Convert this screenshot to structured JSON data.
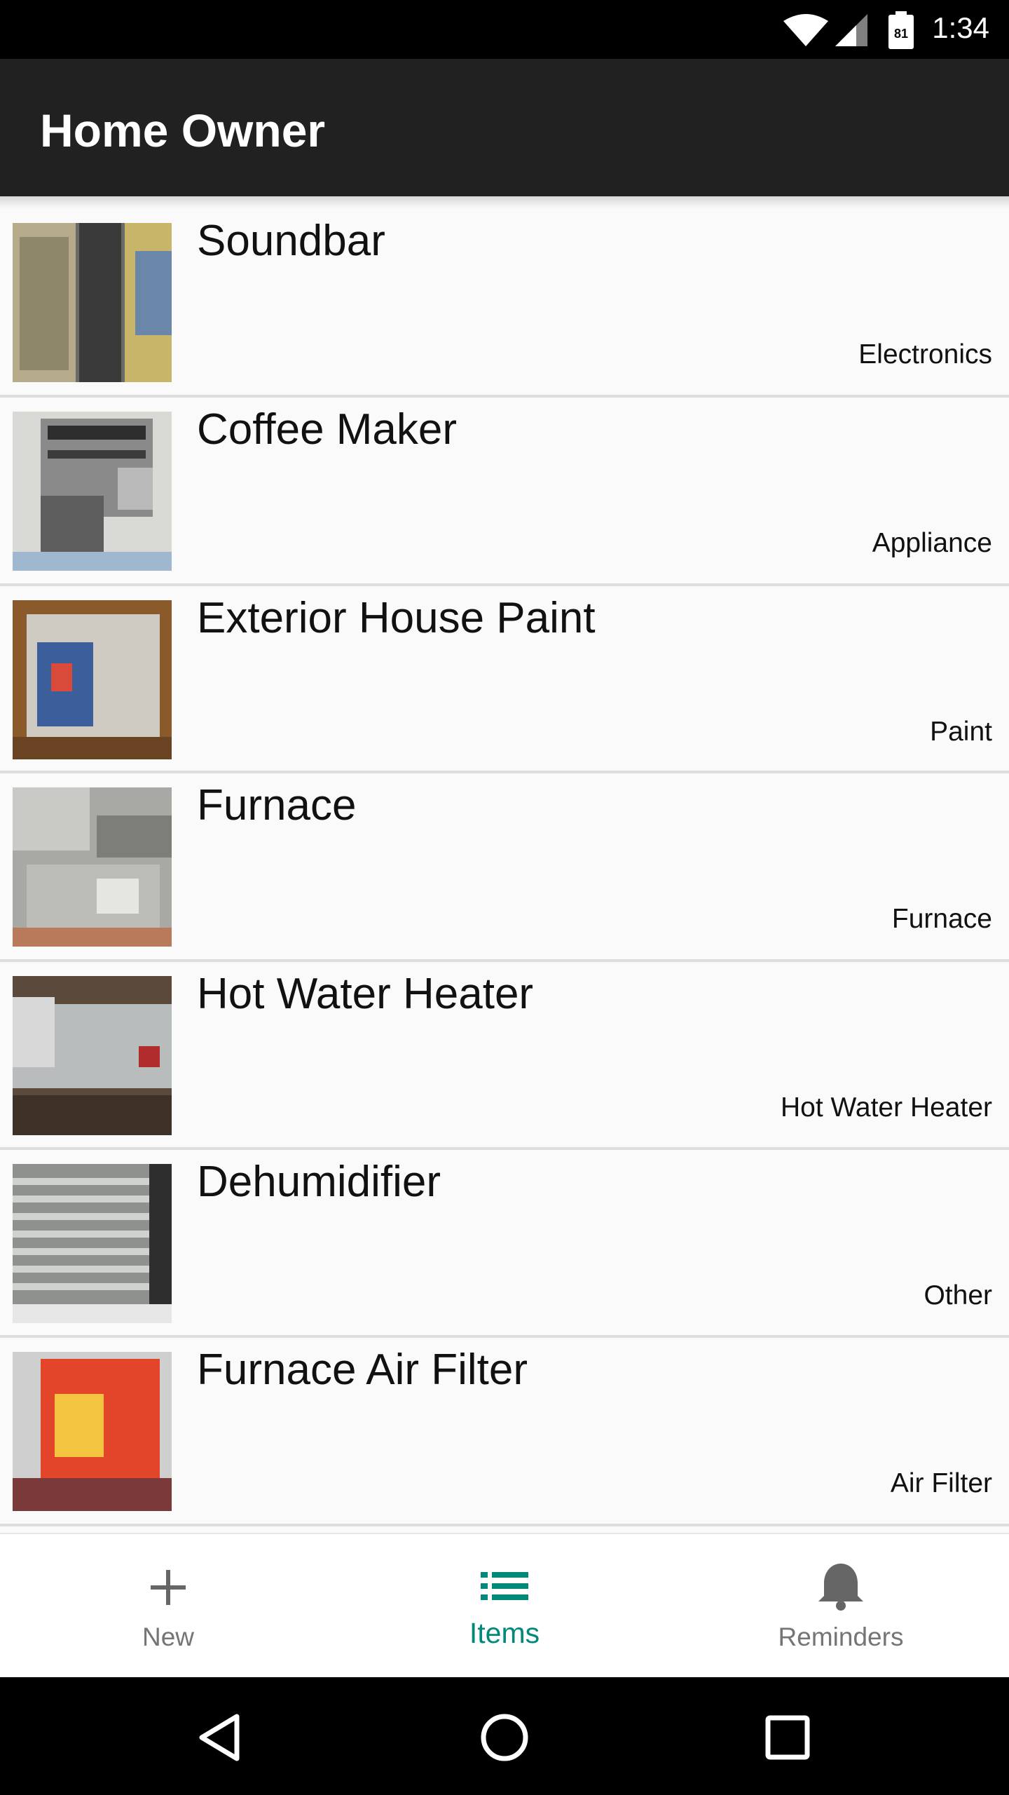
{
  "status_bar": {
    "time": "1:34",
    "battery": "81"
  },
  "app_bar": {
    "title": "Home Owner"
  },
  "items": [
    {
      "name": "Soundbar",
      "category": "Electronics",
      "thumb_icon": "soundbar-photo"
    },
    {
      "name": "Coffee Maker",
      "category": "Appliance",
      "thumb_icon": "coffee-maker-photo"
    },
    {
      "name": "Exterior House Paint",
      "category": "Paint",
      "thumb_icon": "paint-can-photo"
    },
    {
      "name": "Furnace",
      "category": "Furnace",
      "thumb_icon": "furnace-photo"
    },
    {
      "name": "Hot Water Heater",
      "category": "Hot Water Heater",
      "thumb_icon": "water-heater-photo"
    },
    {
      "name": "Dehumidifier",
      "category": "Other",
      "thumb_icon": "dehumidifier-photo"
    },
    {
      "name": "Furnace Air Filter",
      "category": "Air Filter",
      "thumb_icon": "air-filter-photo"
    }
  ],
  "bottom_nav": {
    "new_label": "New",
    "items_label": "Items",
    "reminders_label": "Reminders",
    "active": "Items",
    "accent_color": "#00897b"
  }
}
